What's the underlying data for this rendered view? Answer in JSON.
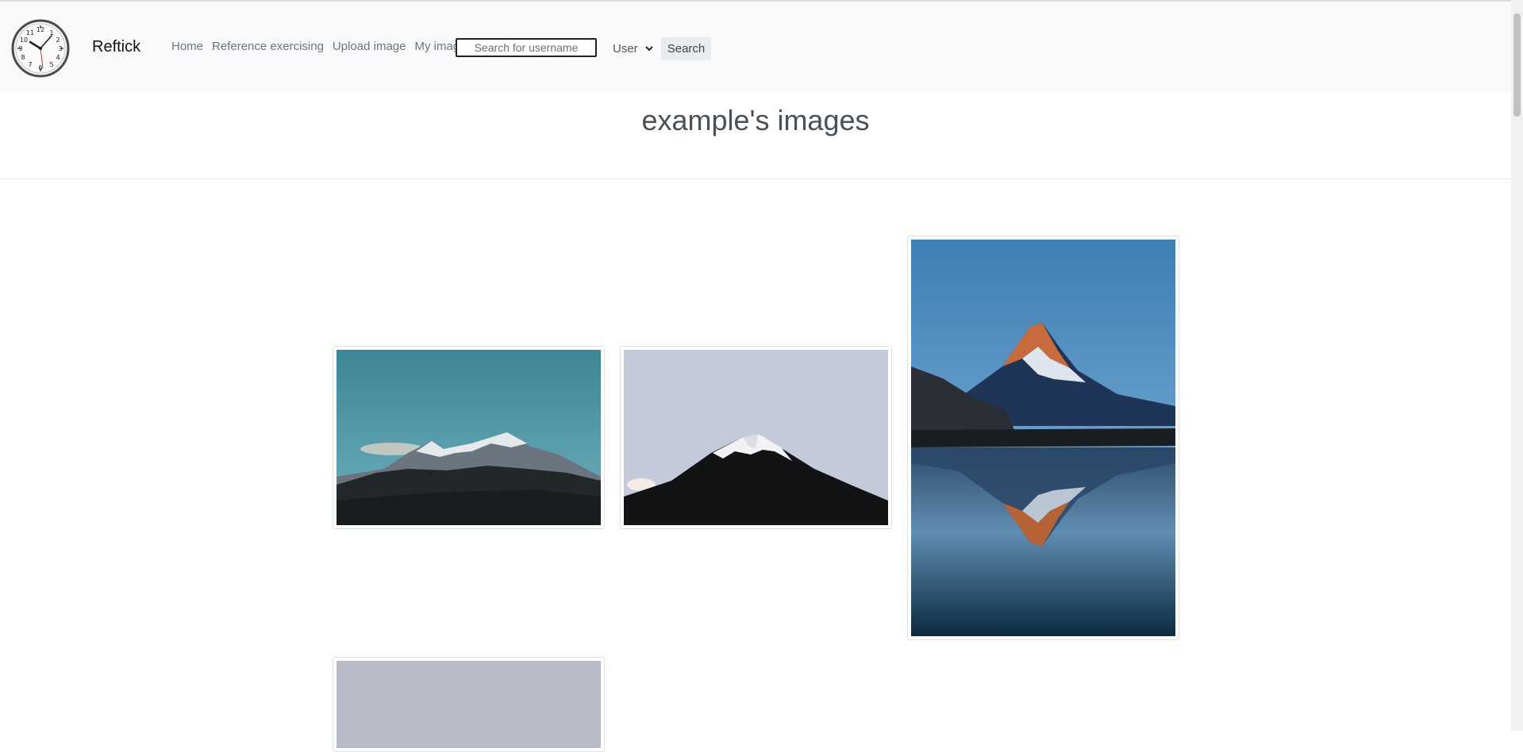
{
  "nav": {
    "brand": "Reftick",
    "links": [
      "Home",
      "Reference exercising",
      "Upload image",
      "My images"
    ],
    "search_placeholder": "Search for username",
    "select_value": "User",
    "search_button": "Search"
  },
  "page": {
    "title": "example's images"
  },
  "icons": {
    "logo": "clock-icon",
    "select": "chevron-down-icon"
  },
  "colors": {
    "navbar_bg": "#f8f9fa",
    "title": "#495057",
    "link": "#6c757d"
  }
}
